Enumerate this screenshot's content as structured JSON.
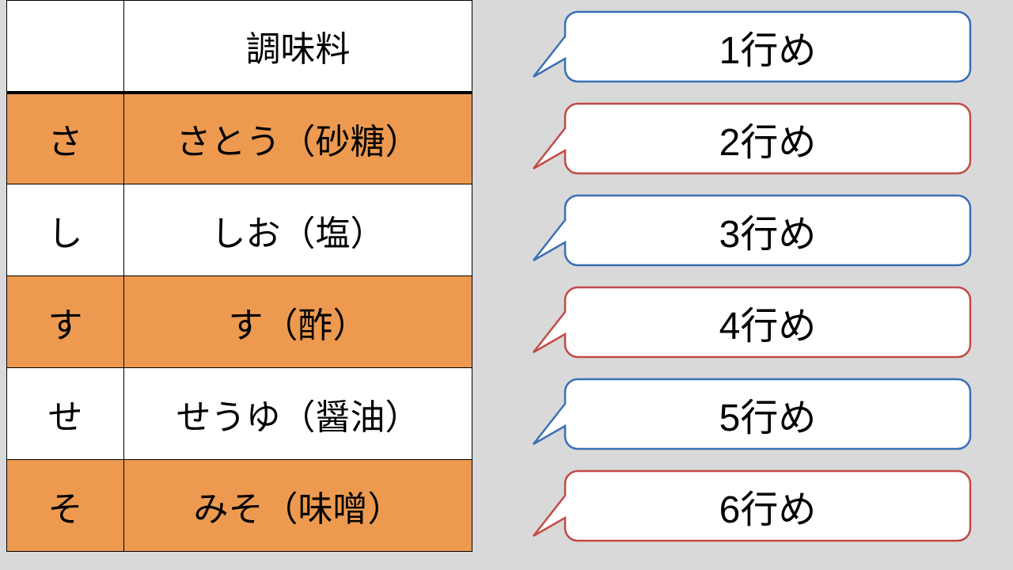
{
  "table": {
    "header": {
      "kana": "",
      "name": "調味料"
    },
    "rows": [
      {
        "kana": "さ",
        "name": "さとう（砂糖）",
        "color": "orange"
      },
      {
        "kana": "し",
        "name": "しお（塩）",
        "color": "white"
      },
      {
        "kana": "す",
        "name": "す（酢）",
        "color": "orange"
      },
      {
        "kana": "せ",
        "name": "せうゆ（醤油）",
        "color": "white"
      },
      {
        "kana": "そ",
        "name": "みそ（味噌）",
        "color": "orange"
      }
    ]
  },
  "callouts": [
    {
      "label": "1行め",
      "stroke": "blue"
    },
    {
      "label": "2行め",
      "stroke": "red"
    },
    {
      "label": "3行め",
      "stroke": "blue"
    },
    {
      "label": "4行め",
      "stroke": "red"
    },
    {
      "label": "5行め",
      "stroke": "blue"
    },
    {
      "label": "6行め",
      "stroke": "red"
    }
  ]
}
